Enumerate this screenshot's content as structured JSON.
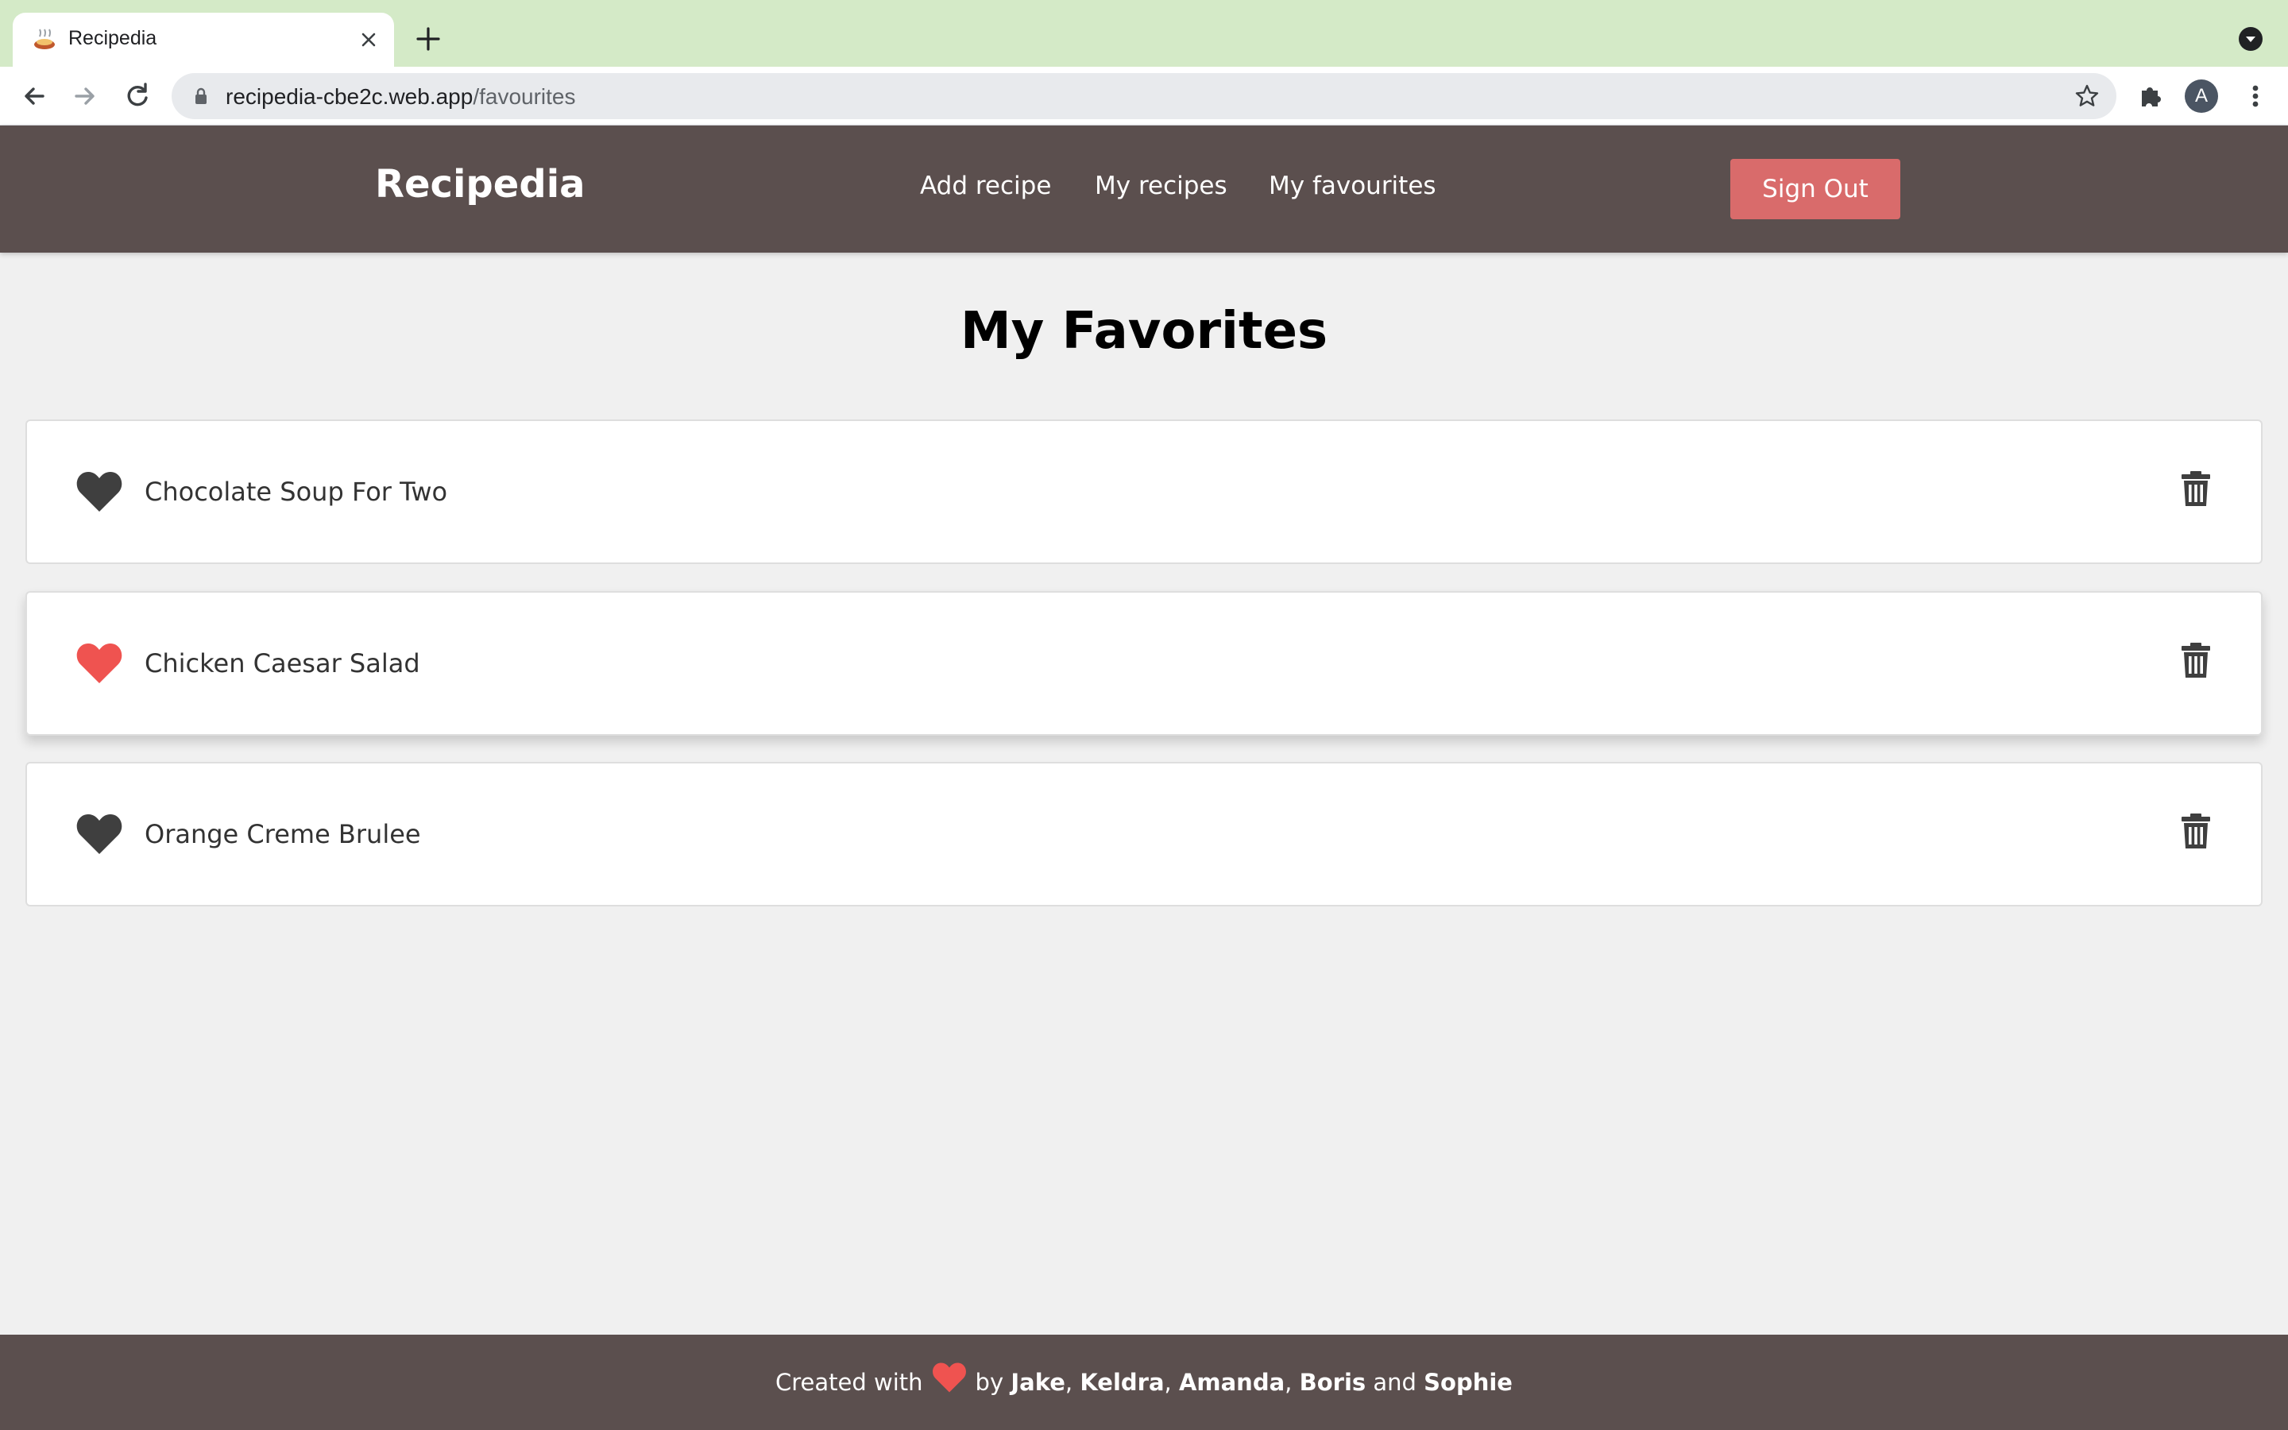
{
  "browser": {
    "tab_title": "Recipedia",
    "url_host": "recipedia-cbe2c.web.app",
    "url_path": "/favourites",
    "profile_initial": "A"
  },
  "header": {
    "brand": "Recipedia",
    "nav": [
      "Add recipe",
      "My recipes",
      "My favourites"
    ],
    "signout_label": "Sign Out"
  },
  "main": {
    "title": "My Favorites",
    "favorites": [
      {
        "name": "Chocolate Soup For Two",
        "heart_color": "#3f3f3f"
      },
      {
        "name": "Chicken Caesar Salad",
        "heart_color": "#ef5350"
      },
      {
        "name": "Orange Creme Brulee",
        "heart_color": "#3f3f3f"
      }
    ]
  },
  "footer": {
    "created_with": "Created with",
    "by": "by",
    "authors": [
      "Jake",
      "Keldra",
      "Amanda",
      "Boris"
    ],
    "and": "and",
    "last_author": "Sophie"
  },
  "colors": {
    "header_bg": "#5b4f4e",
    "signout_bg": "#d96b6b",
    "accent_heart": "#ef5350",
    "page_bg": "#f0f0f0"
  }
}
